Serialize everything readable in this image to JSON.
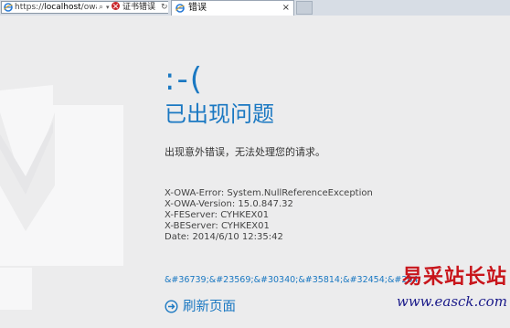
{
  "browser": {
    "address_url_prefix": "https://",
    "address_url_host": "localhost",
    "address_url_path": "/owa",
    "search_glyph": "⌕",
    "dropdown_glyph": "▾",
    "cert_error_label": "证书错误",
    "refresh_glyph": "↻",
    "tab_title": "错误",
    "tab_close": "×",
    "ie_color": "#2a7bd6"
  },
  "error_page": {
    "face": ":-(",
    "title": "已出现问题",
    "message": "出现意外错误，无法处理您的请求。",
    "details": [
      "X-OWA-Error: System.NullReferenceException",
      "X-OWA-Version: 15.0.847.32",
      "X-FEServer: CYHKEX01",
      "X-BEServer: CYHKEX01",
      "Date: 2014/6/10 12:35:42"
    ],
    "entity_text": "&#36739;&#23569;&#30340;&#35814;&#32454;&#204",
    "refresh_label": "刷新页面",
    "accent_color": "#1a78c2"
  },
  "watermark": {
    "chinese": "易采站长站",
    "url": "www.easck.com"
  }
}
